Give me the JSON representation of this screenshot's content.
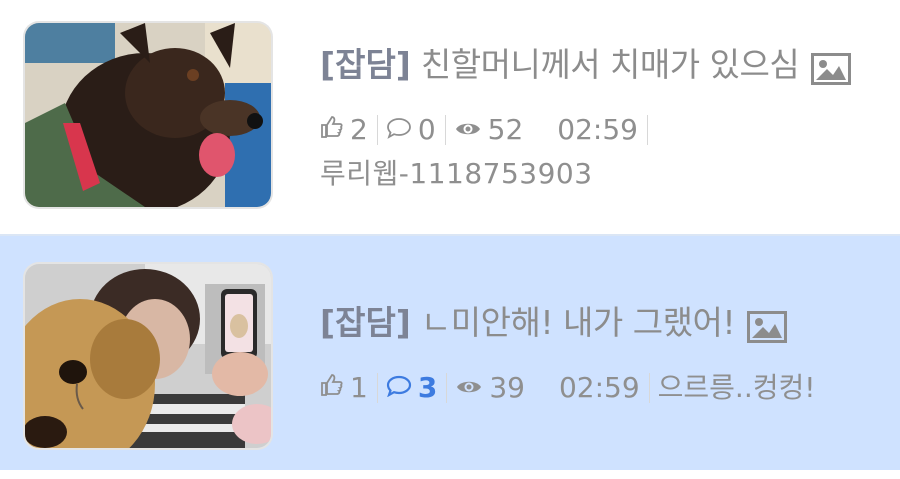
{
  "posts": [
    {
      "category": "[잡담]",
      "title": "친할머니께서 치매가 있으심",
      "has_image_icon": "image-icon",
      "likes": "2",
      "comments": "0",
      "views": "52",
      "time": "02:59",
      "author": "루리웹-1118753903"
    },
    {
      "category": "[잡담]",
      "title": "ㄴ미안해! 내가 그랬어!",
      "has_image_icon": "image-icon",
      "likes": "1",
      "comments": "3",
      "views": "39",
      "time": "02:59",
      "author": "으르릉..컹컹!"
    }
  ],
  "colors": {
    "selected_row_bg": "#cfe2ff",
    "category_text": "#7d8395",
    "title_text": "#8c8c8c",
    "meta_text": "#8f8f8f",
    "active_comment": "#3d7be0"
  }
}
